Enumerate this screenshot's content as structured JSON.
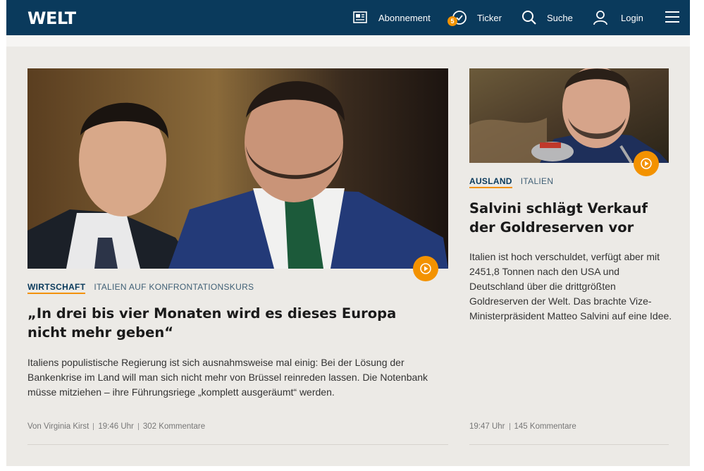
{
  "header": {
    "logo": "WELT",
    "nav": {
      "abonnement": "Abonnement",
      "ticker": "Ticker",
      "ticker_badge": "5",
      "suche": "Suche",
      "login": "Login"
    }
  },
  "articles": [
    {
      "topic": "WIRTSCHAFT",
      "subtopic": "ITALIEN AUF KONFRONTATIONSKURS",
      "headline": "„In drei bis vier Monaten wird es dieses Europa nicht mehr geben“",
      "teaser": "Italiens populistische Regierung ist sich ausnahmsweise mal einig: Bei der Lösung der Bankenkrise im Land will man sich nicht mehr von Brüssel reinreden lassen. Die Notenbank müsse mitziehen – ihre Führungsriege „komplett ausgeräumt“ werden.",
      "author": "Von Virginia Kirst",
      "time": "19:46 Uhr",
      "comments": "302 Kommentare"
    },
    {
      "topic": "AUSLAND",
      "subtopic": "ITALIEN",
      "headline": "Salvini schlägt Verkauf der Goldreserven vor",
      "teaser": "Italien ist hoch verschuldet, verfügt aber mit 2451,8 Tonnen nach den USA und Deutschland über die drittgrößten Goldreserven der Welt. Das brachte Vize-Ministerpräsident Matteo Salvini auf eine Idee.",
      "time": "19:47 Uhr",
      "comments": "145 Kommentare"
    }
  ],
  "colors": {
    "brand": "#0a3a5c",
    "accent": "#f39200",
    "background": "#eceae6"
  }
}
